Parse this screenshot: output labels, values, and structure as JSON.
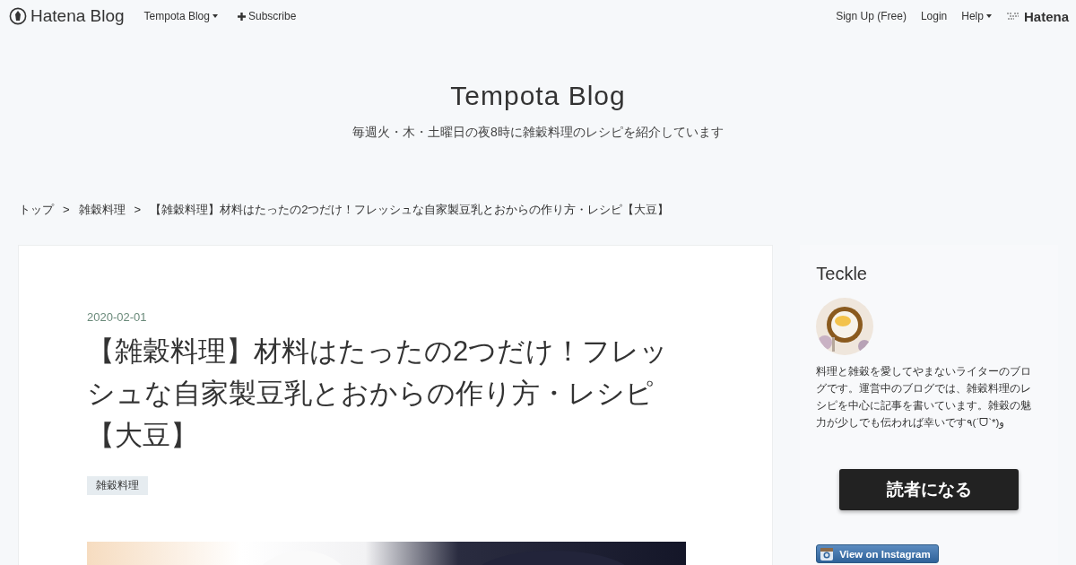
{
  "topbar": {
    "logo": "Hatena Blog",
    "left_links": [
      {
        "label": "Tempota Blog",
        "kind": "dropdown"
      },
      {
        "label": "Subscribe",
        "kind": "plus"
      }
    ],
    "right_links": [
      {
        "label": "Sign Up (Free)",
        "kind": "plain"
      },
      {
        "label": "Login",
        "kind": "plain"
      },
      {
        "label": "Help",
        "kind": "dropdown"
      }
    ],
    "brand": "Hatena"
  },
  "header": {
    "title": "Tempota Blog",
    "subtitle": "毎週火・木・土曜日の夜8時に雑穀料理のレシピを紹介しています"
  },
  "breadcrumb": {
    "separator": ">",
    "items": [
      "トップ",
      "雑穀料理",
      "【雑穀料理】材料はたったの2つだけ！フレッシュな自家製豆乳とおからの作り方・レシピ【大豆】"
    ]
  },
  "article": {
    "date": "2020-02-01",
    "title": "【雑穀料理】材料はたったの2つだけ！フレッシュな自家製豆乳とおからの作り方・レシピ【大豆】",
    "categories": [
      "雑穀料理"
    ],
    "image": {
      "kind": "picture"
    }
  },
  "sidebar": {
    "name": "Teckle",
    "avatar": {
      "kind": "picture"
    },
    "bio": "料理と雑穀を愛してやまないライターのブログです。運営中のブログでは、雑穀料理のレシピを中心に記事を書いています。雑穀の魅力が少しでも伝われば幸いです٩(ˊᗜˋ*)و",
    "follow_button": "読者になる",
    "instagram_button": "View on Instagram"
  }
}
